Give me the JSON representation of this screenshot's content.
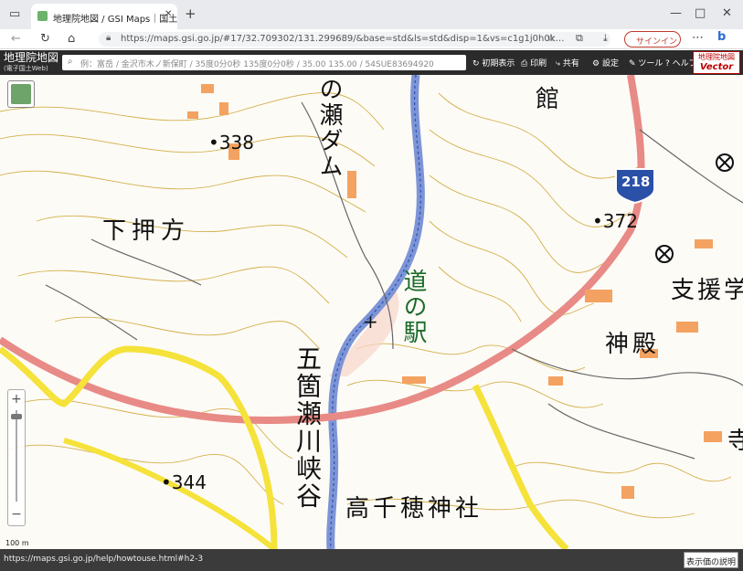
{
  "browser": {
    "tab_title": "地理院地図 / GSI Maps｜国土地…",
    "url": "https://maps.gsi.go.jp/#17/32.709302/131.299689/&base=std&ls=std&disp=1&vs=c1g1j0h0k…",
    "signin_label": "サインイン"
  },
  "gsi_header": {
    "logo_title": "地理院地図",
    "logo_subtitle": "(電子国土Web)",
    "search_placeholder": "例：富岳 / 金沢市木ノ新保町 / 35度0分0秒 135度0分0秒 / 35.00 135.00 / 54SUE83694920",
    "buttons": [
      "初期表示",
      "印刷",
      "共有",
      "設定",
      "ツール",
      "ヘルプ"
    ],
    "vector_title": "地理院地図",
    "vector_label": "Vector"
  },
  "map": {
    "labels": {
      "dam": "の瀬ダム",
      "shimo_oshikata": "下押方",
      "spot_338": "•338",
      "spot_372": "•372",
      "spot_344": "•344",
      "michi_no_eki": "道の駅",
      "gokase_gorge": "五箇瀬川峡谷",
      "shinden": "神殿",
      "takachiho_shrine": "高千穂神社",
      "shien": "支援学",
      "kan": "館",
      "tera": "寺",
      "route": "218"
    },
    "colors": {
      "contour": "#c9a33a",
      "road_major": "#e88a86",
      "road_yellow": "#f5e23a",
      "river": "#7d95d6",
      "building": "#f4a261"
    }
  },
  "status": {
    "link_url": "https://maps.gsi.go.jp/help/howtouse.html#h2-3",
    "scale_text": "100 m",
    "legend_button": "表示価の説明"
  }
}
